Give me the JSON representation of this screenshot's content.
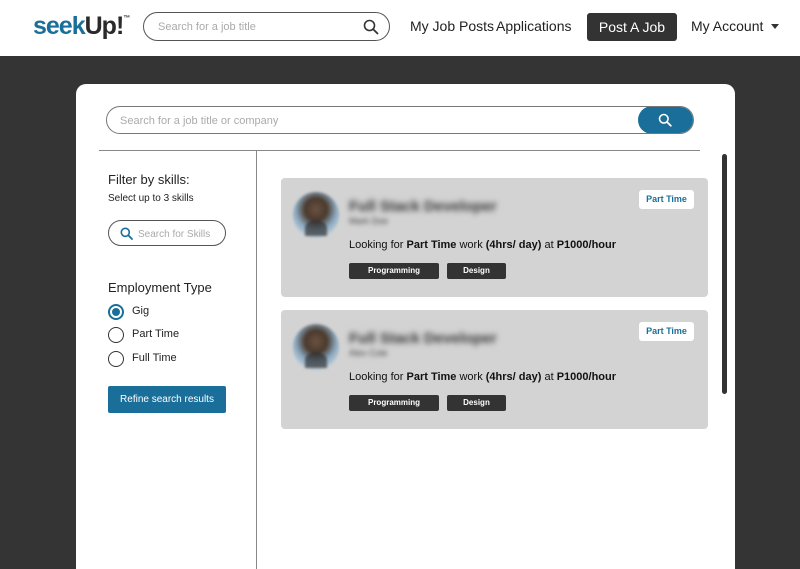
{
  "brand": {
    "logo_part1": "seek",
    "logo_part2": "Up!",
    "logo_tm": "™"
  },
  "header": {
    "search_placeholder": "Search for a job title",
    "nav": {
      "my_job_posts": "My Job Posts",
      "applications": "Applications"
    },
    "post_job_label": "Post A Job",
    "account_label": "My Account"
  },
  "main": {
    "search_placeholder": "Search for a job title or company"
  },
  "sidebar": {
    "filter_title": "Filter by skills:",
    "filter_subtitle": "Select up to 3 skills",
    "skill_search_placeholder": "Search for Skills",
    "employment_title": "Employment Type",
    "employment_options": [
      {
        "label": "Gig",
        "selected": true
      },
      {
        "label": "Part Time",
        "selected": false
      },
      {
        "label": "Full Time",
        "selected": false
      }
    ],
    "refine_label": "Refine search results"
  },
  "jobs": [
    {
      "title": "Full Stack Developer",
      "company": "Mark Doe",
      "badge": "Part Time",
      "desc_prefix": "Looking for ",
      "desc_type": "Part Time",
      "desc_mid": " work ",
      "desc_hours": "(4hrs/ day)",
      "desc_at": " at ",
      "desc_rate": "P1000/hour",
      "tags": [
        "Programming",
        "Design"
      ]
    },
    {
      "title": "Full Stack Developer",
      "company": "Alex Cole",
      "badge": "Part Time",
      "desc_prefix": "Looking for ",
      "desc_type": "Part Time",
      "desc_mid": " work ",
      "desc_hours": "(4hrs/ day)",
      "desc_at": " at ",
      "desc_rate": "P1000/hour",
      "tags": [
        "Programming",
        "Design"
      ]
    }
  ],
  "colors": {
    "accent": "#1a6f9a",
    "dark": "#333333",
    "background": "#343434",
    "card": "#d3d3d3"
  }
}
